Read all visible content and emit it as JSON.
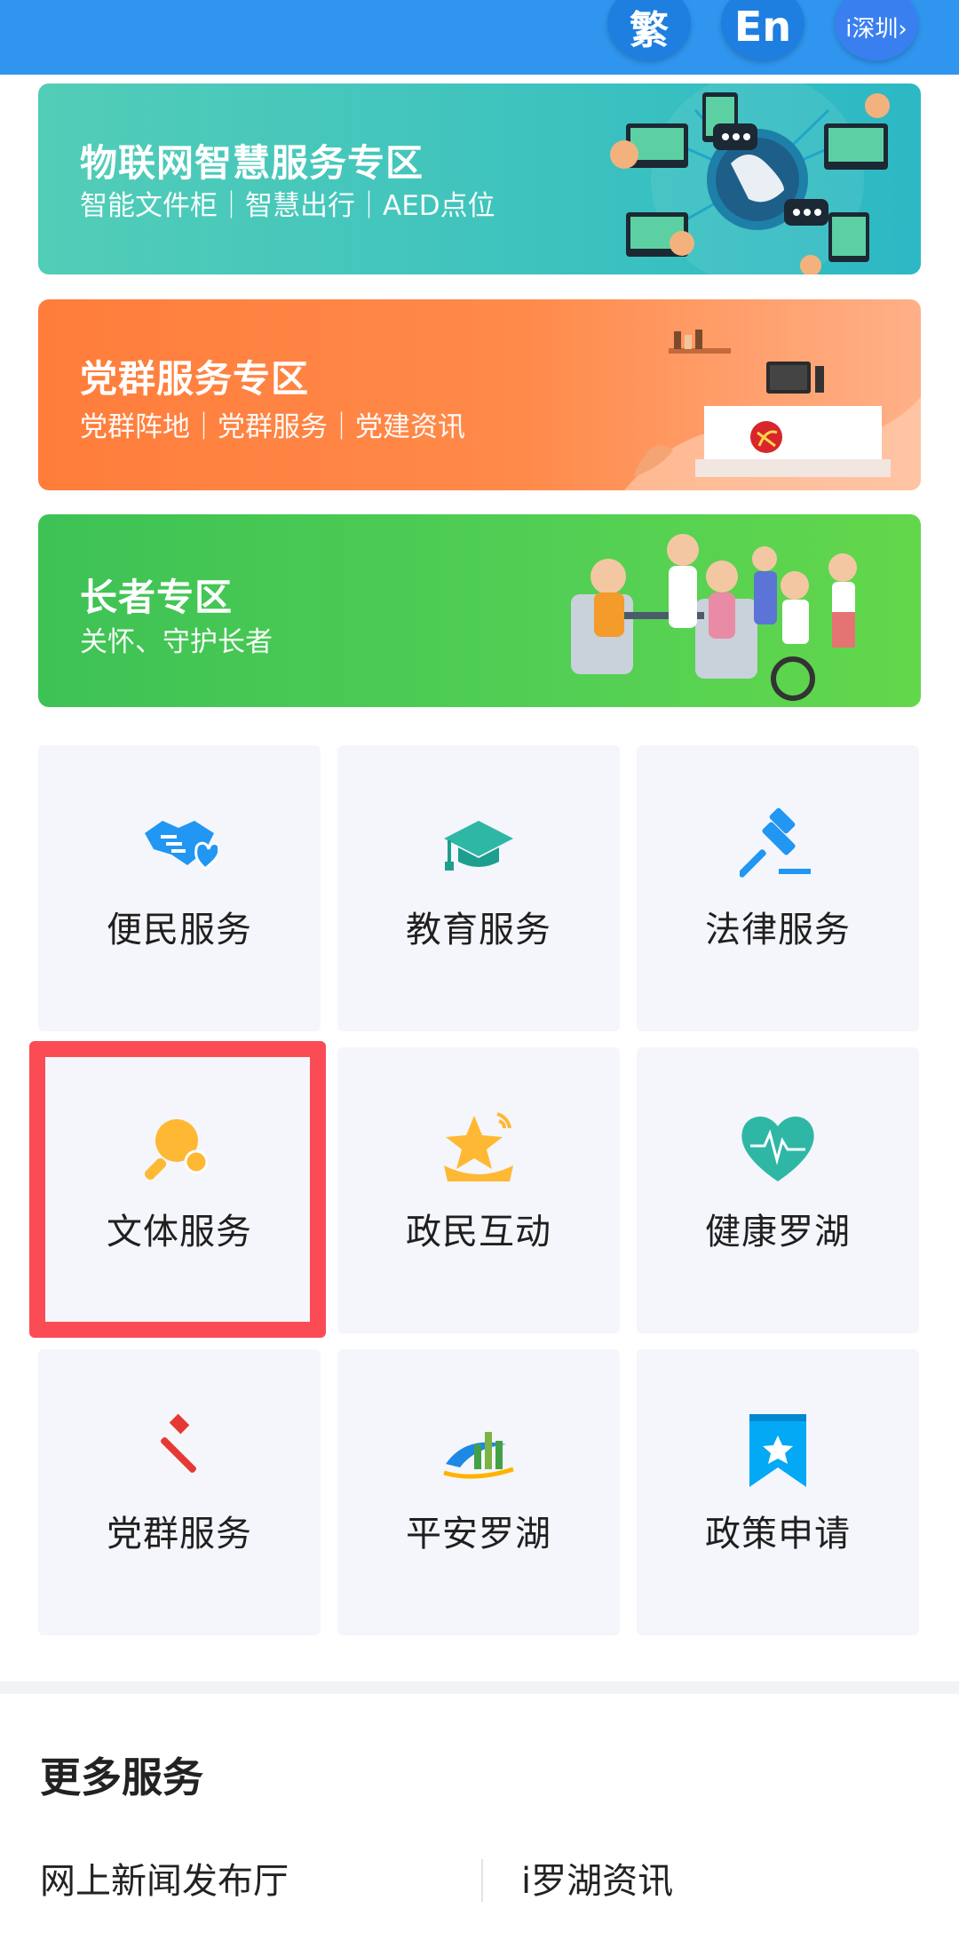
{
  "header": {
    "traditional_label": "繁",
    "english_label": "En",
    "city_label": "i深圳›"
  },
  "banners": [
    {
      "title": "物联网智慧服务专区",
      "subtitle": "智能文件柜｜智慧出行｜AED点位"
    },
    {
      "title": "党群服务专区",
      "subtitle": "党群阵地｜党群服务｜党建资讯"
    },
    {
      "title": "长者专区",
      "subtitle": "关怀、守护长者"
    }
  ],
  "services": [
    {
      "label": "便民服务",
      "icon": "handshake-heart-icon"
    },
    {
      "label": "教育服务",
      "icon": "graduation-cap-icon"
    },
    {
      "label": "法律服务",
      "icon": "gavel-icon"
    },
    {
      "label": "文体服务",
      "icon": "ping-pong-icon"
    },
    {
      "label": "政民互动",
      "icon": "star-icon"
    },
    {
      "label": "健康罗湖",
      "icon": "heart-pulse-icon"
    },
    {
      "label": "党群服务",
      "icon": "hammer-sickle-icon"
    },
    {
      "label": "平安罗湖",
      "icon": "city-shield-icon"
    },
    {
      "label": "政策申请",
      "icon": "bookmark-star-icon"
    }
  ],
  "highlighted_service": "文体服务",
  "more_services": {
    "title": "更多服务",
    "items": [
      "网上新闻发布厅",
      "i罗湖资讯"
    ]
  },
  "colors": {
    "header_blue": "#2f95ee",
    "highlight_red": "#fb4c55",
    "tile_bg": "#f4f6fb",
    "icon_blue": "#2196f3",
    "icon_orange": "#ffb833"
  }
}
